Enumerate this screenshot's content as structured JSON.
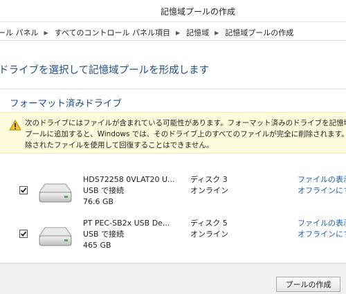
{
  "window": {
    "title": "記憶域プールの作成"
  },
  "breadcrumb": {
    "items": [
      "ール パネル",
      "すべてのコントロール パネル項目",
      "記憶域",
      "記憶域プールの作成"
    ]
  },
  "main": {
    "heading": "ドライブを選択して記憶域プールを形成します",
    "section_heading": "フォーマット済みドライブ",
    "warning": {
      "icon": "warning-icon",
      "text": "次のドライブにはファイルが含まれている可能性があります。フォーマット済みのドライブを記憶域プールに追加すると、Windows では、そのドライブ上のすべてのファイルが完全に削除されます。削除されたファイルを使用して回復することはできません。"
    },
    "drives": [
      {
        "checked": true,
        "name": "HDS72258 0VLAT20 U...",
        "connection": "USB で接続",
        "size": "76.6 GB",
        "disk": "ディスク 3",
        "status": "オンライン",
        "link_view": "ファイルの表示",
        "link_offline": "オフラインにする"
      },
      {
        "checked": true,
        "name": "PT PEC-SB2x USB De...",
        "connection": "USB で接続",
        "size": "465 GB",
        "disk": "ディスク 5",
        "status": "オンライン",
        "link_view": "ファイルの表示",
        "link_offline": "オフラインにする"
      }
    ]
  },
  "footer": {
    "create_button": "プールの作成"
  },
  "colors": {
    "heading": "#1c4e8c",
    "link": "#1a5fb4",
    "warning_bg": "#fffbdd"
  }
}
